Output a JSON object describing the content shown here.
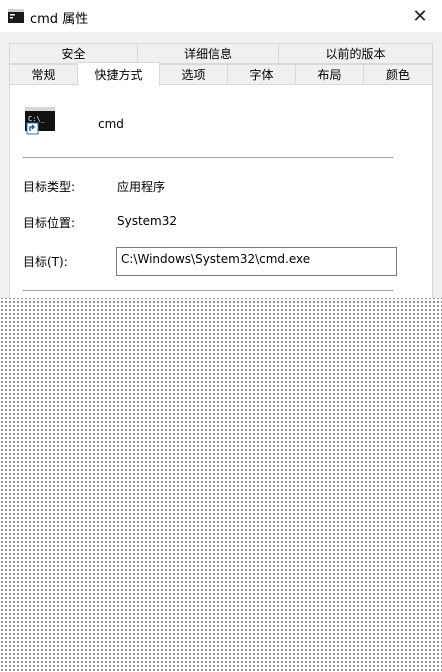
{
  "window": {
    "title": "cmd 属性",
    "close_glyph": "✕"
  },
  "tabs": {
    "row1": [
      "安全",
      "详细信息",
      "以前的版本"
    ],
    "row2": [
      "常规",
      "快捷方式",
      "选项",
      "字体",
      "布局",
      "颜色"
    ],
    "active": "快捷方式"
  },
  "shortcut": {
    "icon_text": "C:\\_",
    "name": "cmd",
    "target_type_label": "目标类型:",
    "target_type_value": "应用程序",
    "target_location_label": "目标位置:",
    "target_location_value": "System32",
    "target_label": "目标(T):",
    "target_value": "C:\\Windows\\System32\\cmd.exe"
  },
  "icons": [
    "cmd-app-icon",
    "close-icon",
    "shortcut-arrow-icon"
  ]
}
